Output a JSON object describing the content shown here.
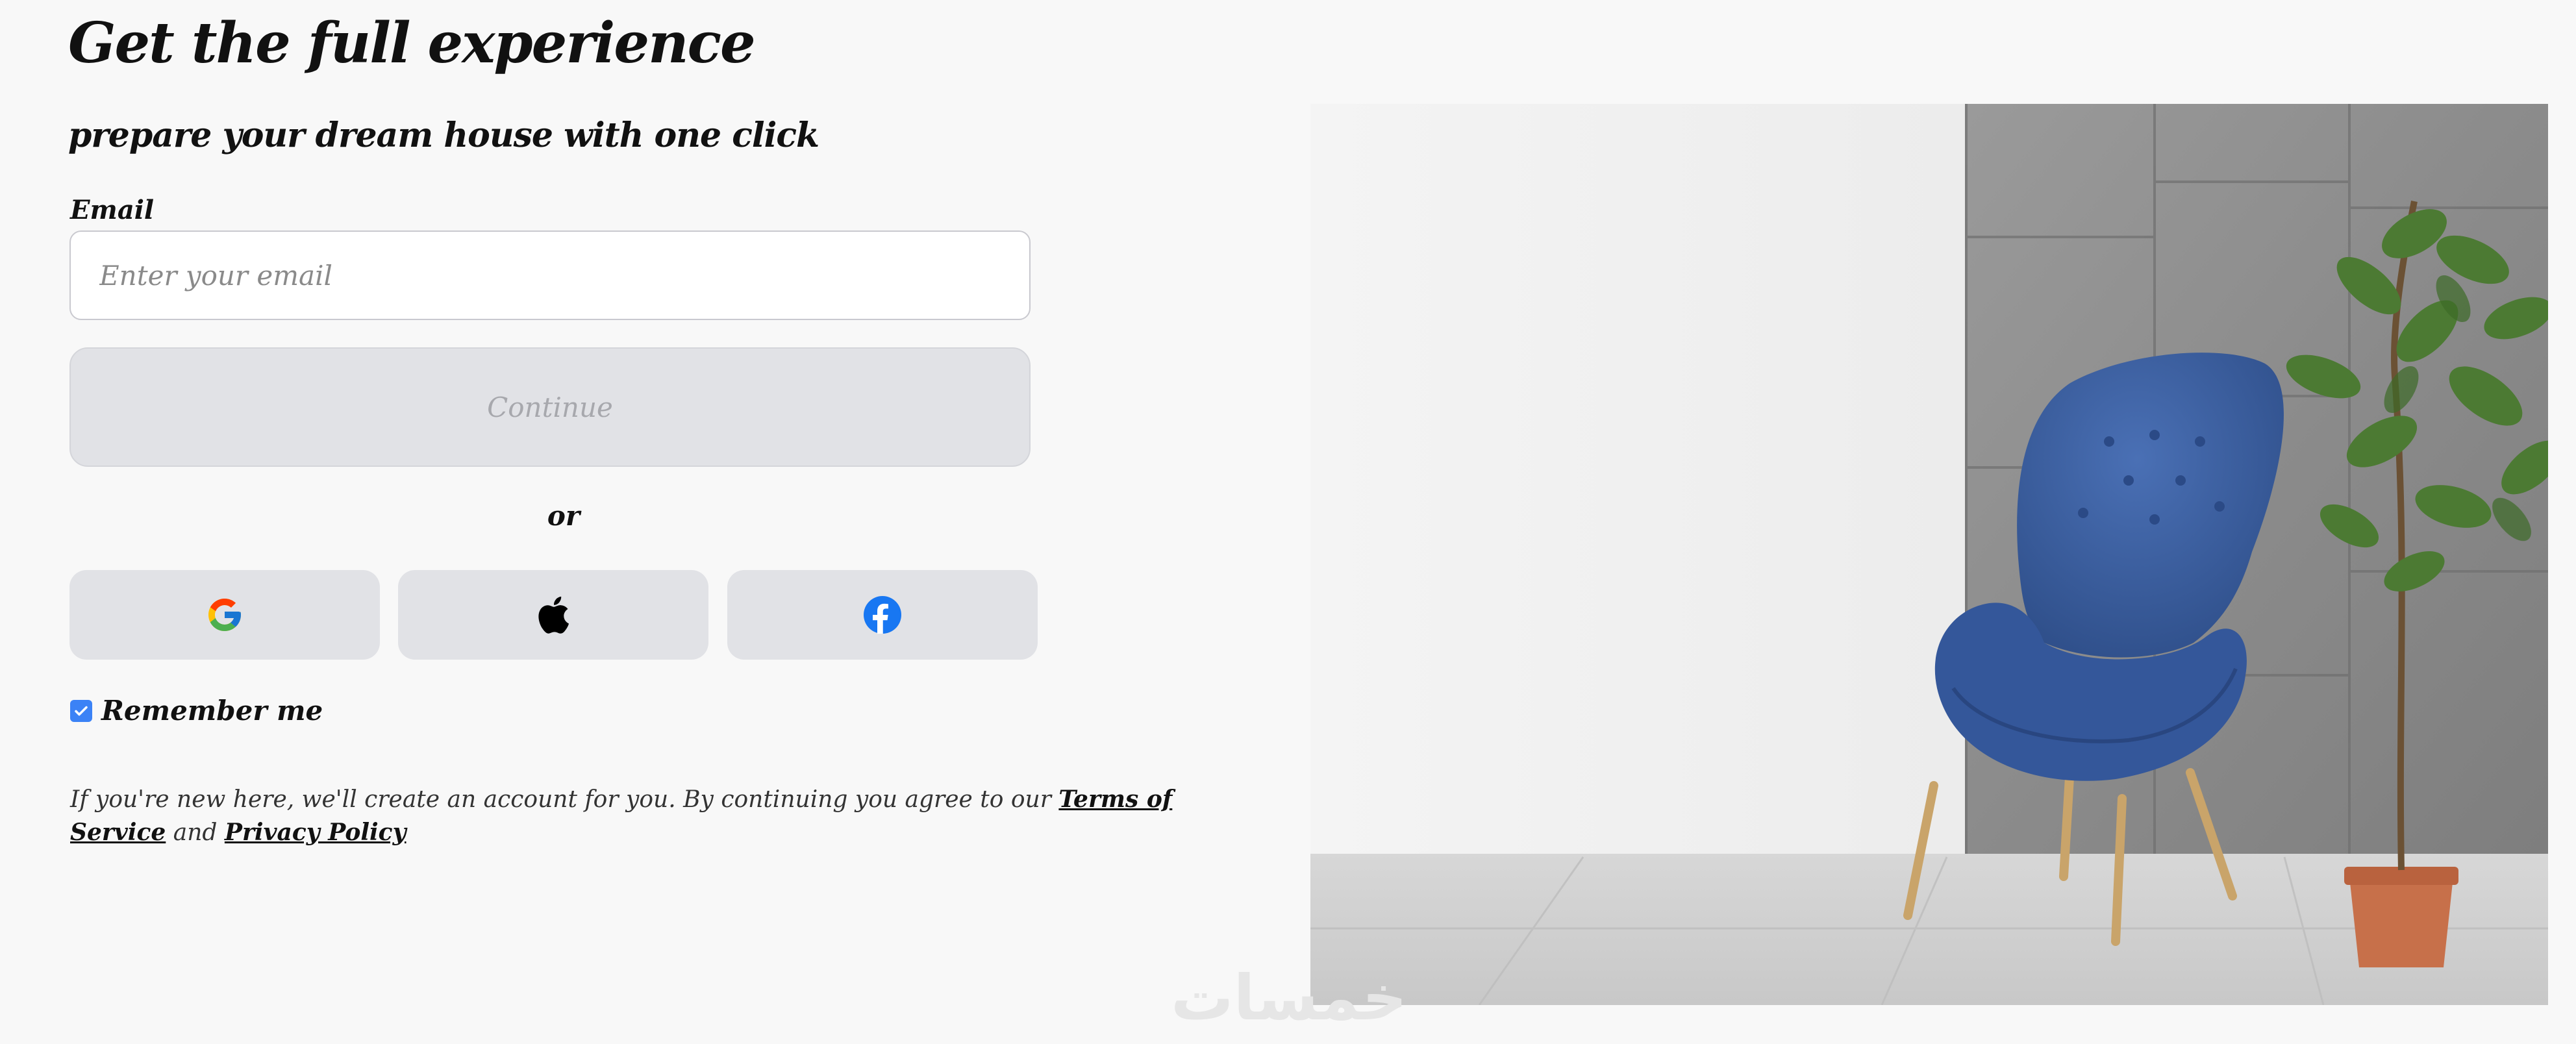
{
  "header": {
    "title": "Get the full experience",
    "subtitle": "prepare your dream house with one click"
  },
  "form": {
    "email_label": "Email",
    "email_placeholder": "Enter your email",
    "email_value": "",
    "continue_label": "Continue",
    "or_label": "or",
    "remember_label": "Remember me",
    "remember_checked": true
  },
  "social": [
    {
      "provider": "Google",
      "icon": "google-icon"
    },
    {
      "provider": "Apple",
      "icon": "apple-icon"
    },
    {
      "provider": "Facebook",
      "icon": "facebook-icon"
    }
  ],
  "legal": {
    "prefix": "If you're new here, we'll create an account for you. By continuing you agree to our ",
    "terms_label": "Terms of Service",
    "middle": " and ",
    "privacy_label": "Privacy Policy"
  },
  "hero_image": {
    "subject": "blue armchair with potted plant"
  },
  "watermark": {
    "text": "خمسات"
  },
  "colors": {
    "accent": "#3b82f6",
    "button_bg": "#e1e2e6",
    "chair": "#3c5f9f",
    "plant_pot": "#c7704a"
  }
}
